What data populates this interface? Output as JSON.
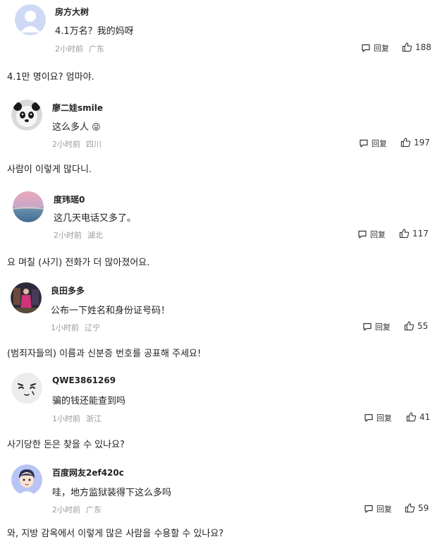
{
  "reply_label": "回复",
  "comments": [
    {
      "username": "房方大树",
      "text": "4.1万名？我的妈呀",
      "time": "2小时前",
      "location": "广东",
      "likes": "188",
      "translation": "4.1만 명이요? 엄마야."
    },
    {
      "username": "廖二娃smile",
      "text": "这么多人",
      "emoji": "😜",
      "time": "2小时前",
      "location": "四川",
      "likes": "197",
      "translation": "사람이 이렇게 많다니."
    },
    {
      "username": "度玮瑶0",
      "text": "这几天电话又多了。",
      "time": "2小时前",
      "location": "湖北",
      "likes": "117",
      "translation": "요 며칠 (사기) 전화가 더 많아졌어요."
    },
    {
      "username": "良田多多",
      "text": "公布一下姓名和身份证号码！",
      "time": "1小时前",
      "location": "辽宁",
      "likes": "55",
      "translation": "(범죄자들의) 이름과 신분증 번호를 공표해 주세요!"
    },
    {
      "username": "QWE3861269",
      "text": "骗的钱还能查到吗",
      "time": "1小时前",
      "location": "浙江",
      "likes": "41",
      "translation": "사기당한 돈은 찾을 수 있나요?"
    },
    {
      "username": "百度网友2ef420c",
      "text": "哇，地方监狱装得下这么多吗",
      "time": "2小时前",
      "location": "广东",
      "likes": "59",
      "translation": "와, 지방 감옥에서 이렇게 많은 사람을 수용할 수 있나요?"
    }
  ]
}
